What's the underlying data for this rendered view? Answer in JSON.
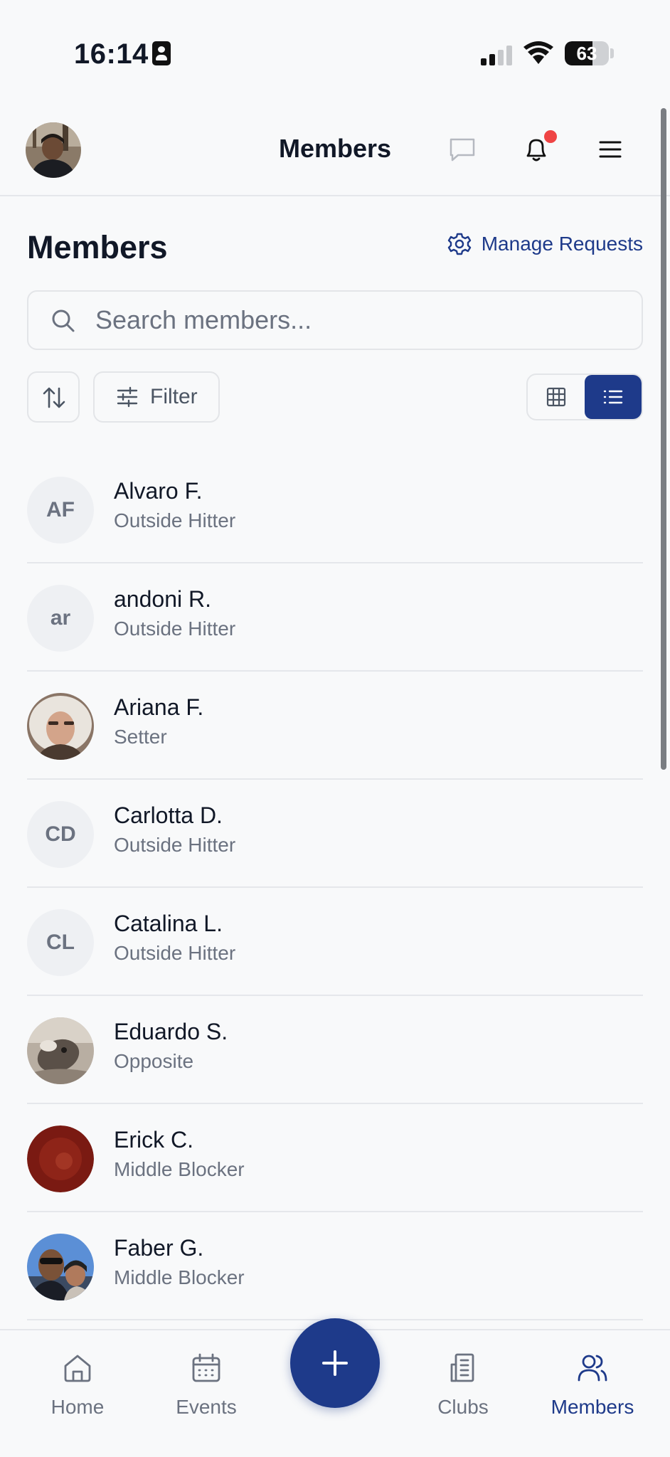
{
  "status_bar": {
    "time": "16:14",
    "battery": "63",
    "battery_level": 0.63
  },
  "header": {
    "title": "Members"
  },
  "main": {
    "title": "Members",
    "manage_requests": "Manage Requests",
    "search": {
      "placeholder": "Search members...",
      "value": ""
    },
    "filter_label": "Filter"
  },
  "members": [
    {
      "initials": "AF",
      "name": "Alvaro F.",
      "role": "Outside Hitter"
    },
    {
      "initials": "ar",
      "name": "andoni R.",
      "role": "Outside Hitter"
    },
    {
      "initials": "",
      "name": "Ariana F.",
      "role": "Setter"
    },
    {
      "initials": "CD",
      "name": "Carlotta D.",
      "role": "Outside Hitter"
    },
    {
      "initials": "CL",
      "name": "Catalina L.",
      "role": "Outside Hitter"
    },
    {
      "initials": "",
      "name": "Eduardo S.",
      "role": "Opposite"
    },
    {
      "initials": "",
      "name": "Erick C.",
      "role": "Middle Blocker"
    },
    {
      "initials": "",
      "name": "Faber G.",
      "role": "Middle Blocker"
    }
  ],
  "bottom_nav": {
    "home": "Home",
    "events": "Events",
    "clubs": "Clubs",
    "members": "Members"
  },
  "colors": {
    "accent": "#1e3a8a",
    "notification": "#ef4444",
    "background": "#f8f9fa"
  }
}
